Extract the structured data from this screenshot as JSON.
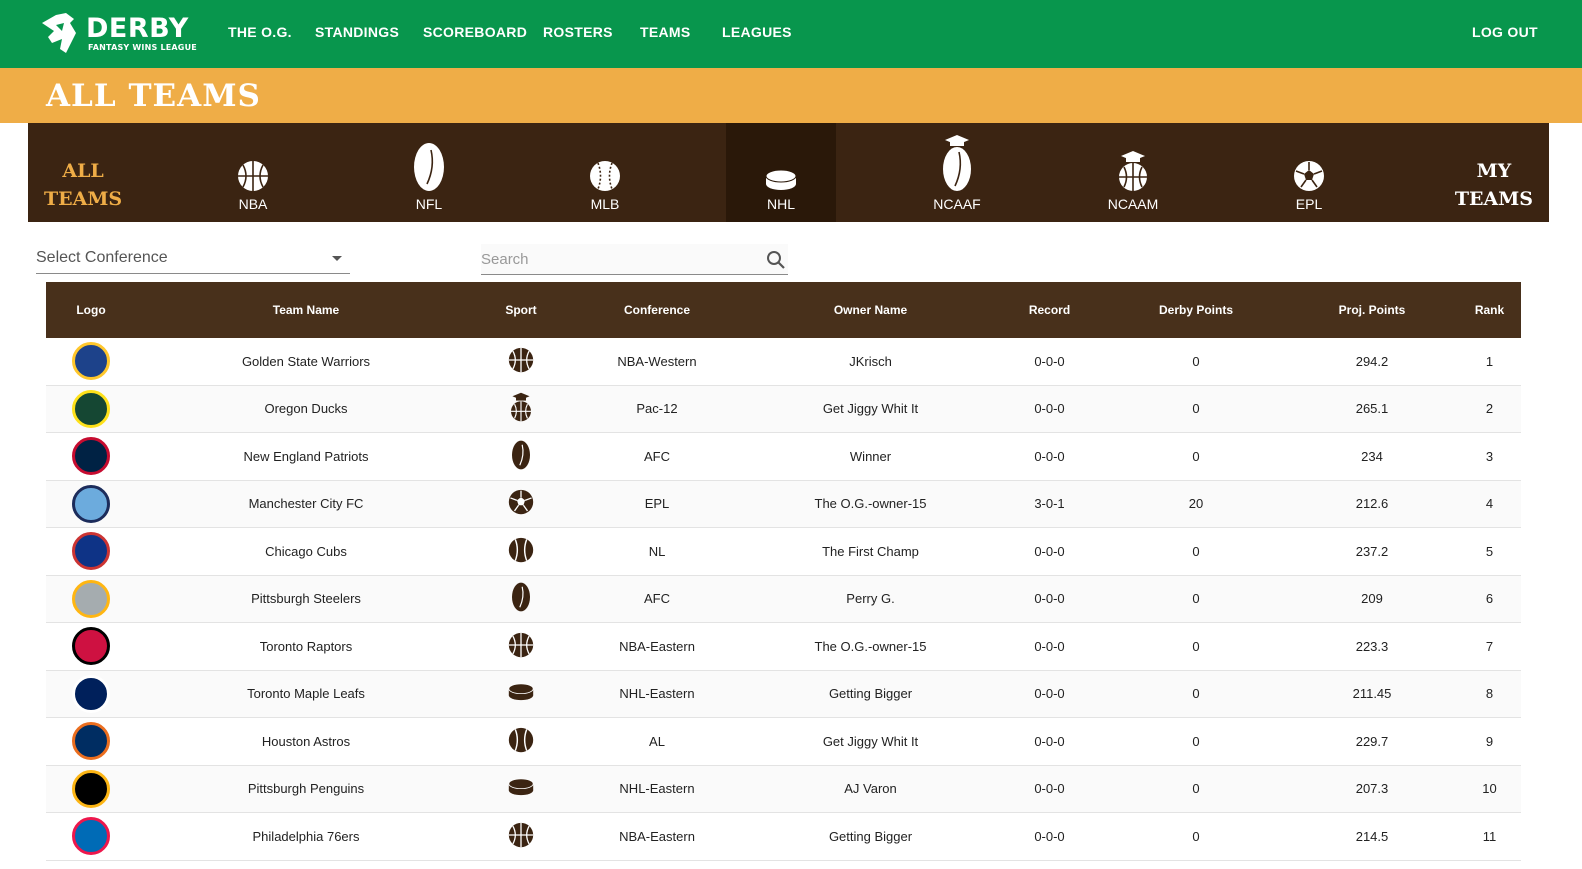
{
  "brand": {
    "word": "DERBY",
    "tagline": "FANTASY WINS LEAGUE"
  },
  "nav": {
    "items": [
      "THE O.G.",
      "STANDINGS",
      "SCOREBOARD",
      "ROSTERS",
      "TEAMS",
      "LEAGUES"
    ],
    "logout": "LOG OUT"
  },
  "page": {
    "title": "ALL TEAMS"
  },
  "sportbar": {
    "all_teams_line1": "ALL",
    "all_teams_line2": "TEAMS",
    "my_teams_line1": "MY",
    "my_teams_line2": "TEAMS",
    "tabs": [
      {
        "label": "NBA",
        "icon": "basketball-icon"
      },
      {
        "label": "NFL",
        "icon": "football-icon"
      },
      {
        "label": "MLB",
        "icon": "baseball-icon"
      },
      {
        "label": "NHL",
        "icon": "hockey-puck-icon",
        "active": true
      },
      {
        "label": "NCAAF",
        "icon": "college-football-icon"
      },
      {
        "label": "NCAAM",
        "icon": "college-basketball-icon"
      },
      {
        "label": "EPL",
        "icon": "soccer-ball-icon"
      }
    ]
  },
  "filters": {
    "conference_placeholder": "Select Conference",
    "search_placeholder": "Search"
  },
  "table": {
    "columns": [
      "Logo",
      "Team Name",
      "Sport",
      "Conference",
      "Owner Name",
      "Record",
      "Derby Points",
      "Proj. Points",
      "Rank"
    ],
    "rows": [
      {
        "team": "Golden State Warriors",
        "sport": "basketball-icon",
        "conference": "NBA-Western",
        "owner": "JKrisch",
        "record": "0-0-0",
        "derby": "0",
        "proj": "294.2",
        "rank": "1",
        "logo_color": "#1d428a",
        "logo_accent": "#ffc72c"
      },
      {
        "team": "Oregon Ducks",
        "sport": "college-basketball-icon",
        "conference": "Pac-12",
        "owner": "Get Jiggy Whit It",
        "record": "0-0-0",
        "derby": "0",
        "proj": "265.1",
        "rank": "2",
        "logo_color": "#154733",
        "logo_accent": "#fee11a"
      },
      {
        "team": "New England Patriots",
        "sport": "football-icon",
        "conference": "AFC",
        "owner": "Winner",
        "record": "0-0-0",
        "derby": "0",
        "proj": "234",
        "rank": "3",
        "logo_color": "#002244",
        "logo_accent": "#c60c30"
      },
      {
        "team": "Manchester City FC",
        "sport": "soccer-ball-icon",
        "conference": "EPL",
        "owner": "The O.G.-owner-15",
        "record": "3-0-1",
        "derby": "20",
        "proj": "212.6",
        "rank": "4",
        "logo_color": "#6cabdd",
        "logo_accent": "#1c2c5b"
      },
      {
        "team": "Chicago Cubs",
        "sport": "baseball-icon",
        "conference": "NL",
        "owner": "The First Champ",
        "record": "0-0-0",
        "derby": "0",
        "proj": "237.2",
        "rank": "5",
        "logo_color": "#0e3386",
        "logo_accent": "#cc3433"
      },
      {
        "team": "Pittsburgh Steelers",
        "sport": "football-icon",
        "conference": "AFC",
        "owner": "Perry G.",
        "record": "0-0-0",
        "derby": "0",
        "proj": "209",
        "rank": "6",
        "logo_color": "#a5acaf",
        "logo_accent": "#ffb612"
      },
      {
        "team": "Toronto Raptors",
        "sport": "basketball-icon",
        "conference": "NBA-Eastern",
        "owner": "The O.G.-owner-15",
        "record": "0-0-0",
        "derby": "0",
        "proj": "223.3",
        "rank": "7",
        "logo_color": "#ce1141",
        "logo_accent": "#000000"
      },
      {
        "team": "Toronto Maple Leafs",
        "sport": "hockey-puck-icon",
        "conference": "NHL-Eastern",
        "owner": "Getting Bigger",
        "record": "0-0-0",
        "derby": "0",
        "proj": "211.45",
        "rank": "8",
        "logo_color": "#00205b",
        "logo_accent": "#ffffff"
      },
      {
        "team": "Houston Astros",
        "sport": "baseball-icon",
        "conference": "AL",
        "owner": "Get Jiggy Whit It",
        "record": "0-0-0",
        "derby": "0",
        "proj": "229.7",
        "rank": "9",
        "logo_color": "#002d62",
        "logo_accent": "#eb6e1f"
      },
      {
        "team": "Pittsburgh Penguins",
        "sport": "hockey-puck-icon",
        "conference": "NHL-Eastern",
        "owner": "AJ Varon",
        "record": "0-0-0",
        "derby": "0",
        "proj": "207.3",
        "rank": "10",
        "logo_color": "#000000",
        "logo_accent": "#fcb514"
      },
      {
        "team": "Philadelphia 76ers",
        "sport": "basketball-icon",
        "conference": "NBA-Eastern",
        "owner": "Getting Bigger",
        "record": "0-0-0",
        "derby": "0",
        "proj": "214.5",
        "rank": "11",
        "logo_color": "#006bb6",
        "logo_accent": "#ed174c"
      }
    ]
  },
  "colors": {
    "nav_green": "#08964d",
    "title_orange": "#efad47",
    "sportbar_brown": "#3b2412",
    "header_brown": "#48301b"
  }
}
